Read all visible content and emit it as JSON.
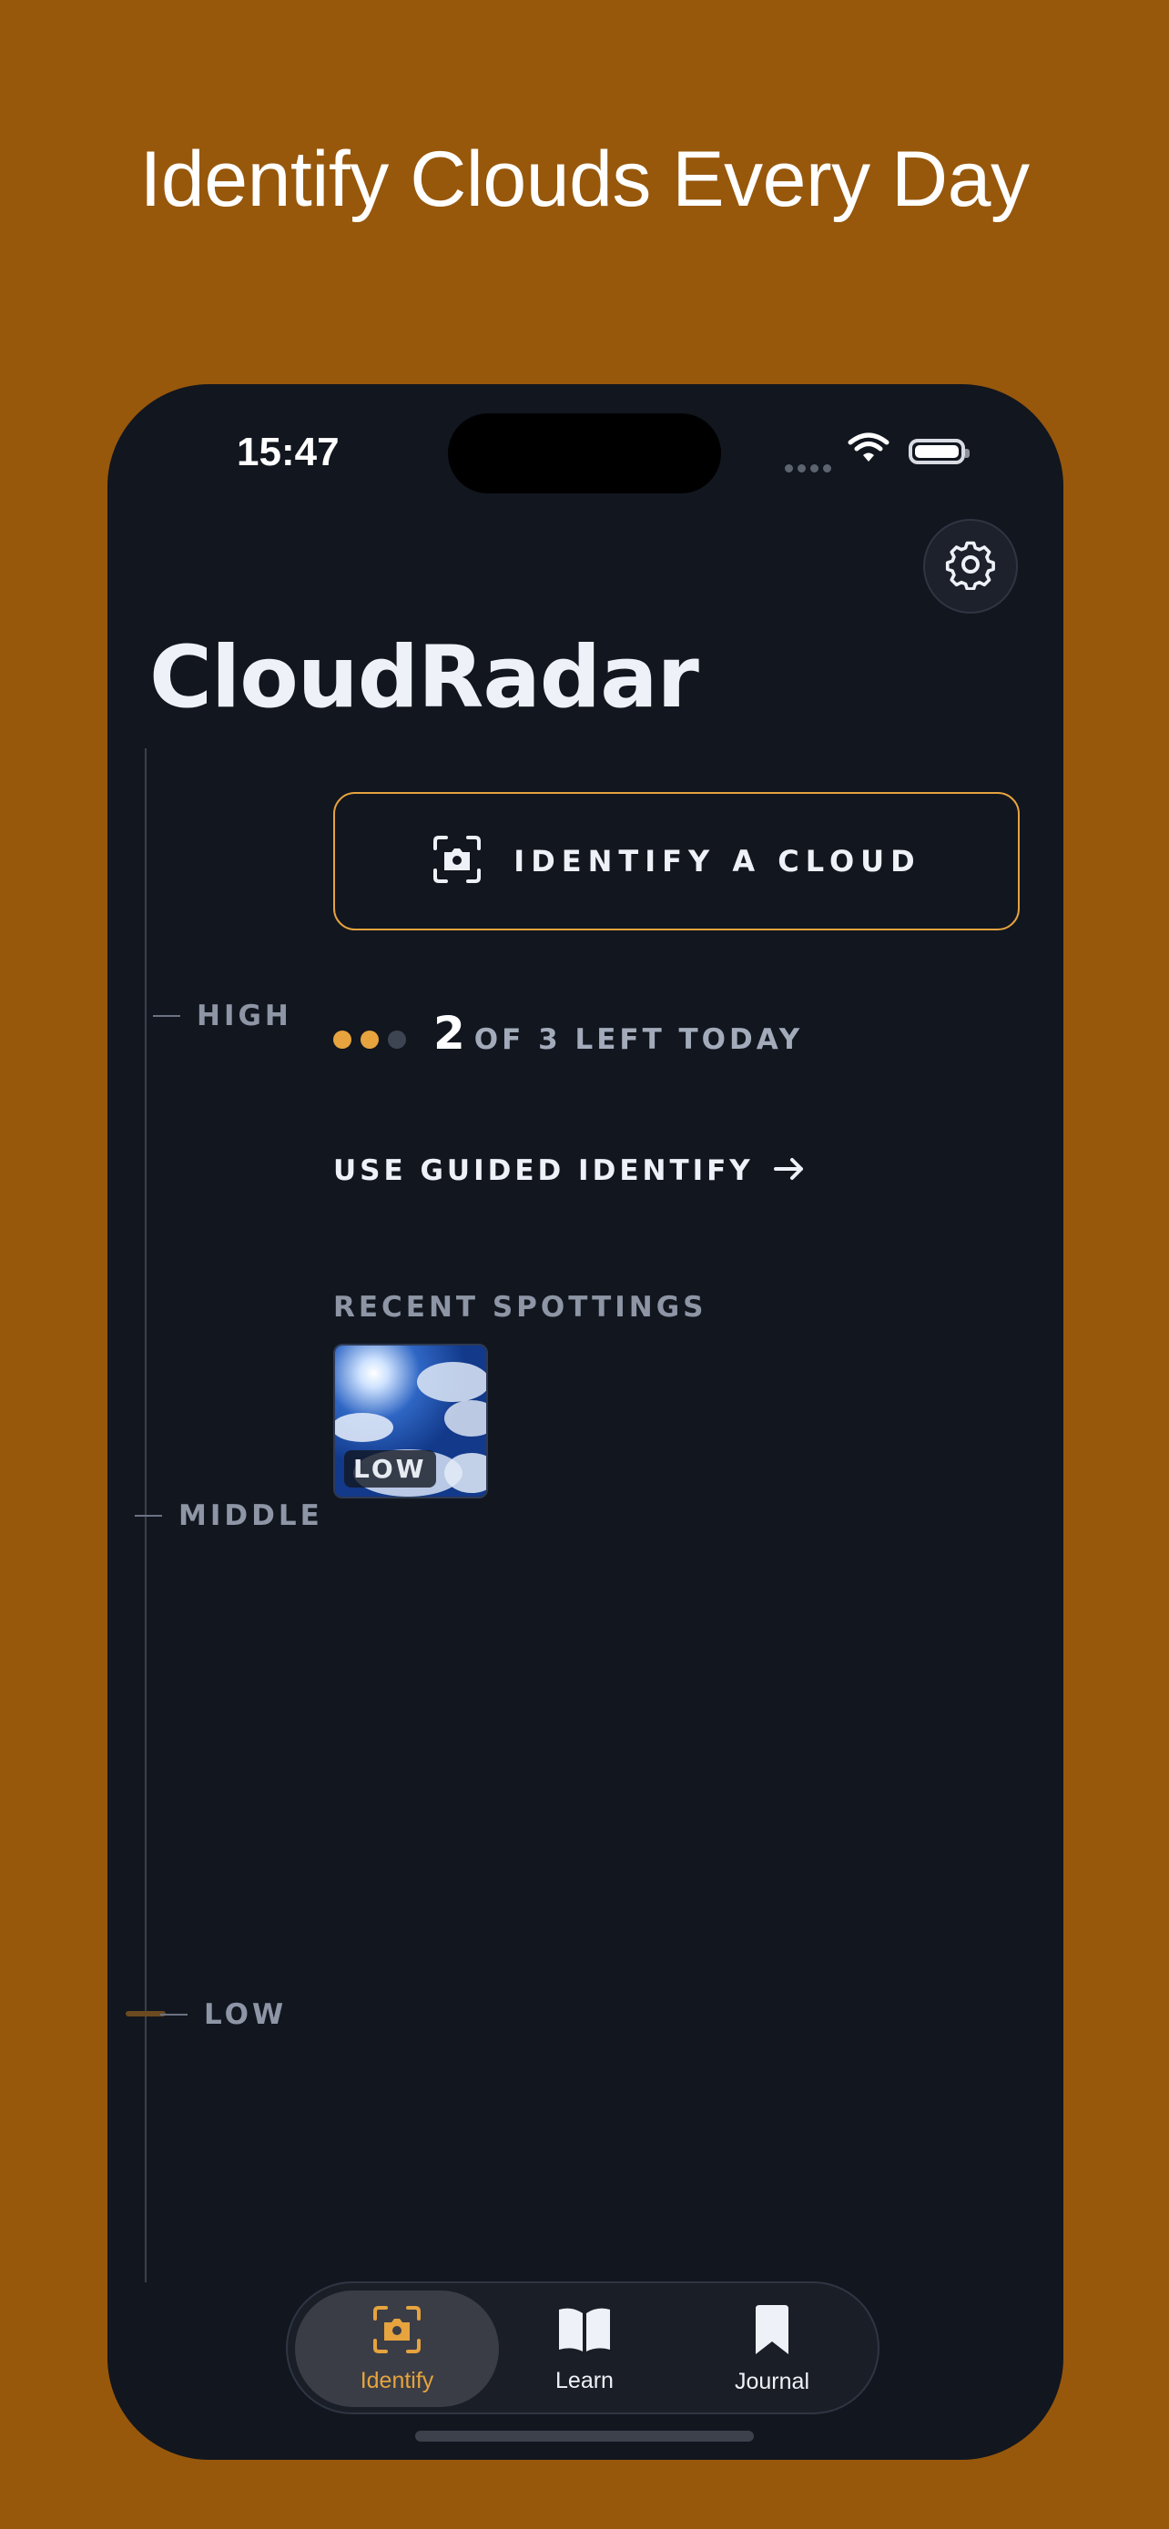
{
  "headline": "Identify Clouds Every Day",
  "status_bar": {
    "time": "15:47",
    "wifi_icon": "wifi-icon",
    "battery_icon": "battery-icon"
  },
  "header": {
    "title": "CloudRadar",
    "settings_icon": "gear-icon"
  },
  "altitude_scale": {
    "labels": {
      "high": "HIGH",
      "middle": "MIDDLE",
      "low": "LOW"
    },
    "current_marker": "LOW"
  },
  "identify": {
    "button_label": "IDENTIFY A CLOUD",
    "icon": "camera-scan-icon"
  },
  "quota": {
    "remaining": "2",
    "text": "OF 3 LEFT TODAY",
    "used": 1,
    "total": 3
  },
  "guided": {
    "label": "USE GUIDED IDENTIFY",
    "icon": "arrow-right-icon"
  },
  "recent": {
    "title": "RECENT SPOTTINGS",
    "items": [
      {
        "tag": "LOW"
      }
    ]
  },
  "tabbar": {
    "tabs": [
      {
        "label": "Identify",
        "icon": "camera-scan-icon",
        "active": true
      },
      {
        "label": "Learn",
        "icon": "book-icon",
        "active": false
      },
      {
        "label": "Journal",
        "icon": "bookmark-icon",
        "active": false
      }
    ]
  },
  "colors": {
    "background": "#97580c",
    "screen": "#12161f",
    "accent": "#e6a33e",
    "text": "#eef1f7",
    "muted": "#8e96a6"
  }
}
